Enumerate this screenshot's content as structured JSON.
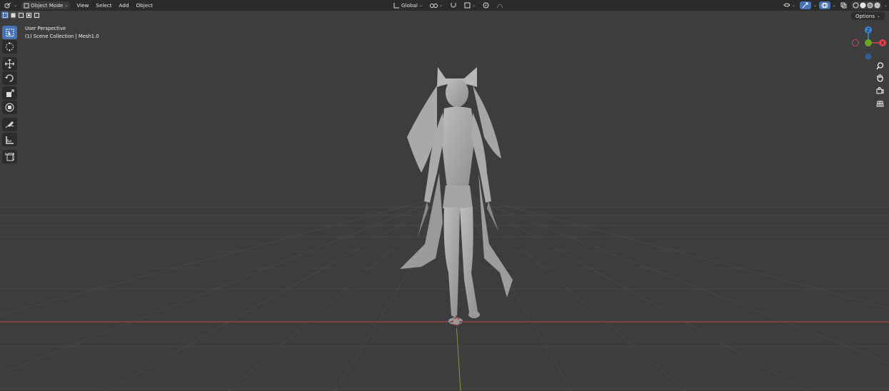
{
  "header": {
    "editor_type_icon": "3d-viewport-icon",
    "mode_label": "Object Mode",
    "menus": [
      "View",
      "Select",
      "Add",
      "Object"
    ],
    "transform_orientation": "Global",
    "options_label": "Options"
  },
  "overlay": {
    "view_name": "User Perspective",
    "collection_info": "(1) Scene Collection | Mesh1.0"
  },
  "gizmo": {
    "z_label": "Z",
    "x_label": "X",
    "colors": {
      "x": "#e0414b",
      "y": "#6aa623",
      "z": "#3a86d9"
    }
  },
  "tools": [
    "select-box-icon",
    "cursor-icon",
    "move-icon",
    "rotate-icon",
    "scale-icon",
    "transform-icon",
    "annotate-icon",
    "measure-icon",
    "add-cube-icon"
  ],
  "nav": [
    "zoom-icon",
    "hand-pan-icon",
    "camera-icon",
    "grid-ortho-icon"
  ],
  "colors": {
    "viewport_bg": "#3d3d3d",
    "header_bg": "#2b2b2b",
    "active_tool": "#4772b3",
    "x_axis_line": "#b8464b",
    "y_axis_line": "#7a9a3a"
  }
}
